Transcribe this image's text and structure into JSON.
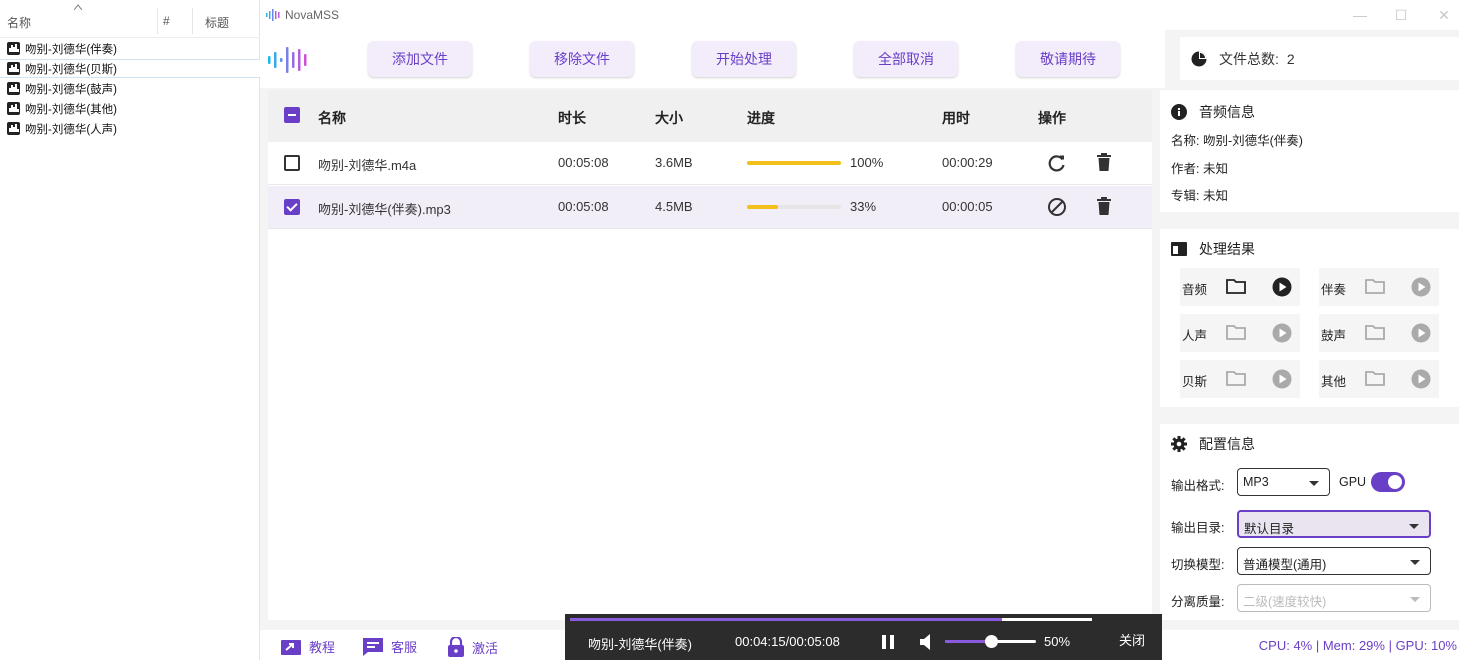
{
  "explorer": {
    "columns": [
      "名称",
      "#",
      "标题"
    ],
    "files": [
      {
        "name": "吻别-刘德华(伴奏)",
        "selected": false
      },
      {
        "name": "吻别-刘德华(贝斯)",
        "selected": true
      },
      {
        "name": "吻别-刘德华(鼓声)",
        "selected": false
      },
      {
        "name": "吻别-刘德华(其他)",
        "selected": false
      },
      {
        "name": "吻别-刘德华(人声)",
        "selected": false
      }
    ]
  },
  "app": {
    "title": "NovaMSS",
    "window_controls": [
      "—",
      "☐",
      "✕"
    ]
  },
  "toolbar": {
    "buttons": [
      "添加文件",
      "移除文件",
      "开始处理",
      "全部取消",
      "敬请期待"
    ]
  },
  "file_count": {
    "label": "文件总数:",
    "value": "2"
  },
  "table": {
    "headers": {
      "name": "名称",
      "duration": "时长",
      "size": "大小",
      "progress": "进度",
      "elapsed": "用时",
      "actions": "操作"
    },
    "rows": [
      {
        "name": "吻别-刘德华.m4a",
        "duration": "00:05:08",
        "size": "3.6MB",
        "progress": 100,
        "progress_label": "100%",
        "elapsed": "00:00:29",
        "checked": false,
        "action_icon": "refresh-icon"
      },
      {
        "name": "吻别-刘德华(伴奏).mp3",
        "duration": "00:05:08",
        "size": "4.5MB",
        "progress": 33,
        "progress_label": "33%",
        "elapsed": "00:00:05",
        "checked": true,
        "action_icon": "cancel-icon"
      }
    ]
  },
  "audio_info": {
    "title": "音频信息",
    "name_label": "名称:",
    "name_value": "吻别-刘德华(伴奏)",
    "author_label": "作者:",
    "author_value": "未知",
    "album_label": "专辑:",
    "album_value": "未知"
  },
  "results": {
    "title": "处理结果",
    "items": [
      "音频",
      "伴奏",
      "人声",
      "鼓声",
      "贝斯",
      "其他"
    ]
  },
  "config": {
    "title": "配置信息",
    "format_label": "输出格式:",
    "format_value": "MP3",
    "gpu_label": "GPU",
    "gpu_on": true,
    "dir_label": "输出目录:",
    "dir_value": "默认目录",
    "model_label": "切换模型:",
    "model_value": "普通模型(通用)",
    "quality_label": "分离质量:",
    "quality_value": "二级(速度较快)"
  },
  "player": {
    "track": "吻别-刘德华(伴奏)",
    "time": "00:04:15/00:05:08",
    "position_fraction": 0.828,
    "volume_percent": 50,
    "volume_label": "50%",
    "close_label": "关闭"
  },
  "bottom": {
    "tutorial": "教程",
    "support": "客服",
    "activate": "激活",
    "stats": "CPU: 4% | Mem: 29% | GPU: 10%"
  },
  "colors": {
    "accent": "#6a3fc8",
    "progress": "#f3bf1a"
  }
}
